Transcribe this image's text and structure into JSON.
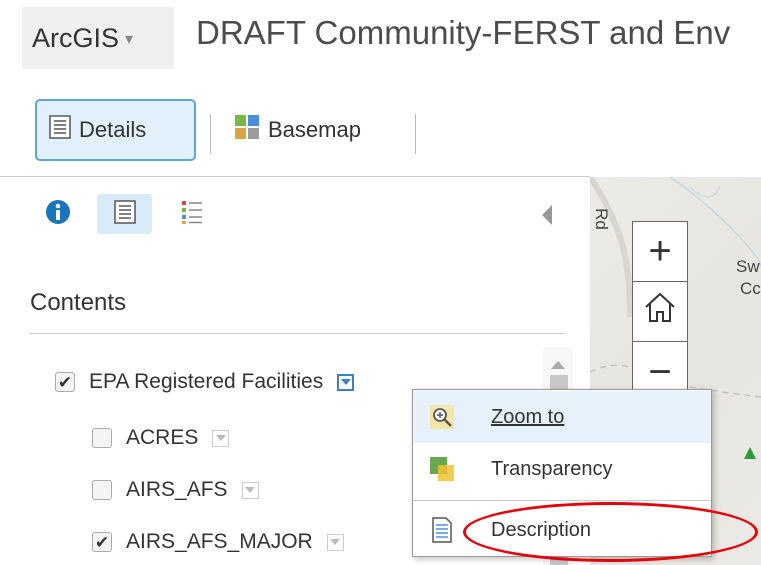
{
  "header": {
    "app_button_label": "ArcGIS",
    "app_button_caret": "▾",
    "title": "DRAFT Community-FERST and Env"
  },
  "toolbar": {
    "details_label": "Details",
    "basemap_label": "Basemap"
  },
  "panel": {
    "contents_title": "Contents",
    "layers": [
      {
        "label": "EPA Registered Facilities",
        "checked": true,
        "indent": 0
      },
      {
        "label": "ACRES",
        "checked": false,
        "indent": 1
      },
      {
        "label": "AIRS_AFS",
        "checked": false,
        "indent": 1
      },
      {
        "label": "AIRS_AFS_MAJOR",
        "checked": true,
        "indent": 1
      }
    ],
    "checkmark": "✔"
  },
  "map": {
    "zoom_in": "+",
    "zoom_out": "−",
    "labels": [
      "Rd",
      "Sw",
      "Cc"
    ]
  },
  "context_menu": {
    "items": [
      {
        "label": "Zoom to",
        "icon": "zoom-to-icon",
        "hover": true
      },
      {
        "label": "Transparency",
        "icon": "transparency-icon",
        "hover": false
      },
      {
        "label": "Description",
        "icon": "description-icon",
        "hover": false
      }
    ]
  },
  "colors": {
    "accent": "#61a4d6",
    "highlight": "#e8000b"
  }
}
